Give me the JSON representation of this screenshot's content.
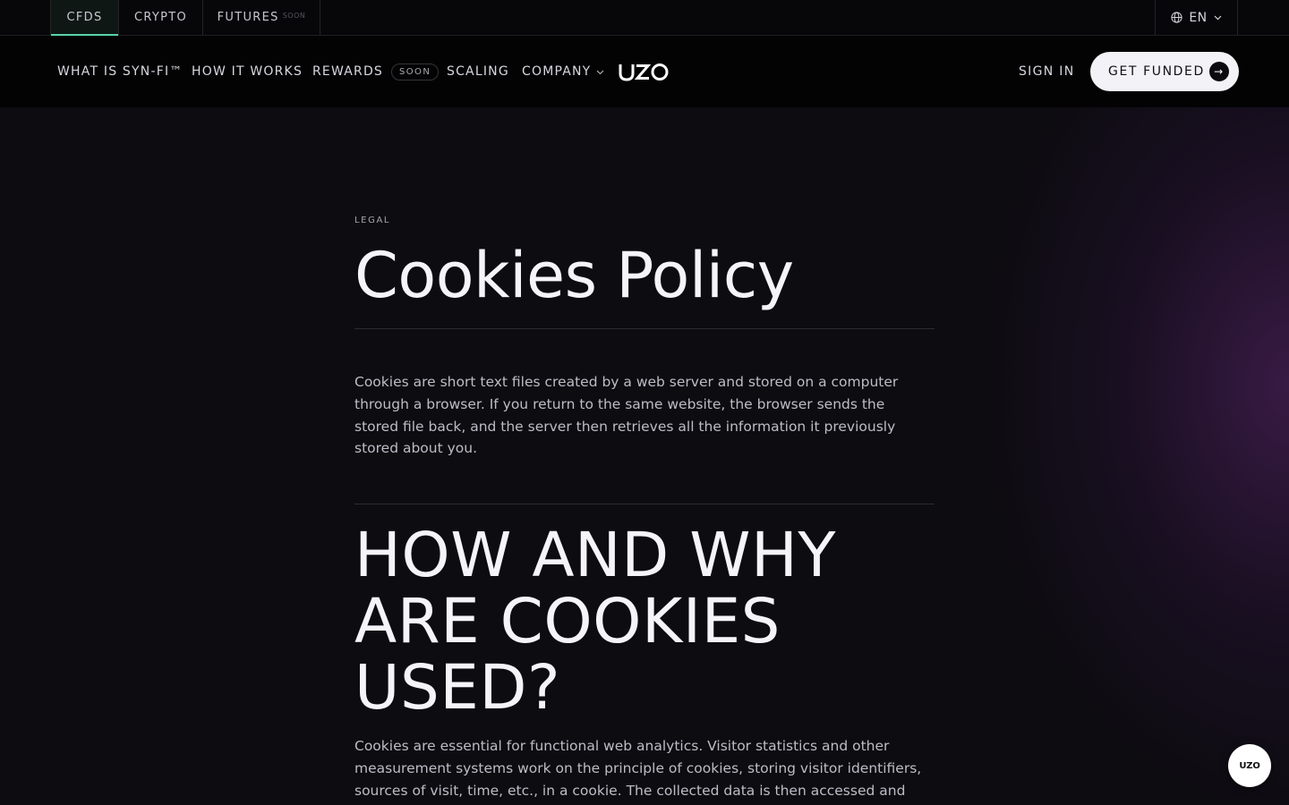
{
  "topbar": {
    "tabs": [
      {
        "label": "CFDS",
        "active": true
      },
      {
        "label": "CRYPTO",
        "active": false
      },
      {
        "label": "FUTURES",
        "badge": "SOON",
        "disabled": true
      }
    ],
    "language": {
      "label": "EN",
      "icon": "globe-icon"
    }
  },
  "nav": {
    "items": {
      "synfi": "WHAT IS SYN-FI™",
      "how": "HOW IT WORKS",
      "rewards": "REWARDS",
      "rewards_badge": "SOON",
      "scaling": "SCALING",
      "company": "COMPANY"
    },
    "logo": "UZO",
    "sign_in": "SIGN IN",
    "cta": "GET FUNDED"
  },
  "content": {
    "eyebrow": "LEGAL",
    "title": "Cookies Policy",
    "intro": "Cookies are short text files created by a web server and stored on a computer through a browser. If you return to the same website, the browser sends the stored file back, and the server then retrieves all the information it previously stored about you.",
    "section_title": "HOW AND WHY ARE COOKIES USED?",
    "section_body": "Cookies are essential for functional web analytics. Visitor statistics and other measurement systems work on the principle of cookies, storing visitor identifiers, sources of visit, time, etc., in a cookie. The collected data is then accessed and"
  },
  "floating_badge": "UZO",
  "colors": {
    "accent": "#58d3a9",
    "background": "#0d0c11",
    "cta_bg": "#f3f2f6"
  }
}
